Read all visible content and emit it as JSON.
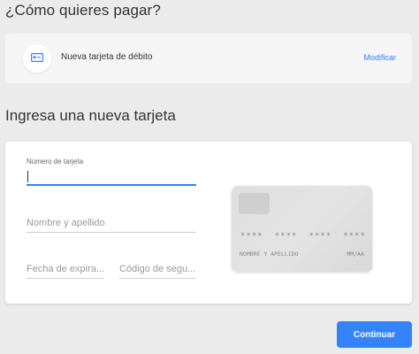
{
  "header": {
    "title": "¿Cómo quieres pagar?"
  },
  "payment_method": {
    "icon": "card-icon",
    "label": "Nueva tarjeta de débito",
    "modify_label": "Modificar"
  },
  "new_card": {
    "title": "Ingresa una nueva tarjeta",
    "card_number": {
      "label": "Número de tarjeta",
      "value": ""
    },
    "name": {
      "placeholder": "Nombre y apellido",
      "value": ""
    },
    "expiry": {
      "placeholder": "Fecha de expira...",
      "value": ""
    },
    "cvv": {
      "placeholder": "Código de segu...",
      "value": ""
    }
  },
  "card_preview": {
    "number_groups": [
      "****",
      "****",
      "****",
      "****"
    ],
    "holder": "NOMBRE Y APELLIDO",
    "expiry": "MM/AA"
  },
  "actions": {
    "continue_label": "Continuar"
  },
  "colors": {
    "accent": "#3483fa",
    "background": "#ebebeb"
  }
}
